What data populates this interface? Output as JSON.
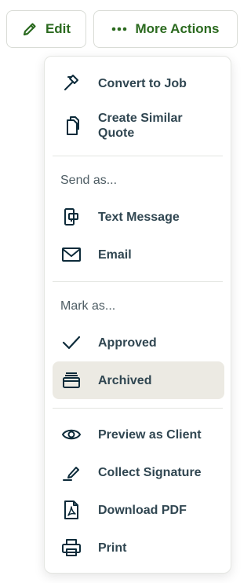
{
  "toolbar": {
    "edit_label": "Edit",
    "more_label": "More Actions",
    "accent": "#2b6a1f"
  },
  "menu": {
    "items_top": [
      {
        "label": "Convert to Job",
        "icon": "hammer-icon"
      },
      {
        "label": "Create Similar Quote",
        "icon": "copy-icon"
      }
    ],
    "send_header": "Send as...",
    "send_items": [
      {
        "label": "Text Message",
        "icon": "phone-message-icon"
      },
      {
        "label": "Email",
        "icon": "envelope-icon"
      }
    ],
    "mark_header": "Mark as...",
    "mark_items": [
      {
        "label": "Approved",
        "icon": "checkmark-icon"
      },
      {
        "label": "Archived",
        "icon": "archive-icon",
        "selected": true
      }
    ],
    "other_items": [
      {
        "label": "Preview as Client",
        "icon": "eye-icon"
      },
      {
        "label": "Collect Signature",
        "icon": "pen-signature-icon"
      },
      {
        "label": "Download PDF",
        "icon": "pdf-file-icon"
      },
      {
        "label": "Print",
        "icon": "printer-icon"
      }
    ]
  }
}
